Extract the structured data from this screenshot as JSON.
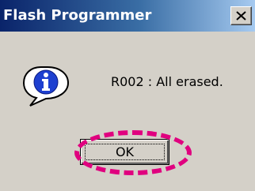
{
  "window": {
    "title": "Flash Programmer",
    "close_icon": "close-icon"
  },
  "dialog": {
    "icon": "info-icon",
    "message": "R002 : All erased.",
    "ok_label": "OK"
  },
  "annotation": {
    "highlight_color": "#e0007f",
    "highlight_target": "ok-button"
  },
  "colors": {
    "titlebar_start": "#0a246a",
    "titlebar_end": "#a6caf0",
    "dialog_bg": "#d4d0c8"
  }
}
